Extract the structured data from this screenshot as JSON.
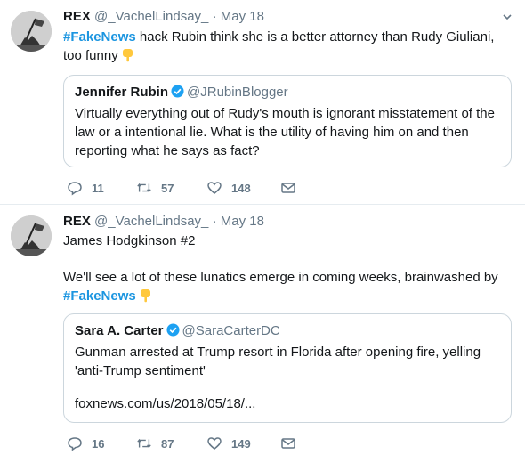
{
  "tweets": [
    {
      "name": "REX",
      "handle": "@_VachelLindsay_",
      "separator": "·",
      "time": "May 18",
      "hashtag": "#FakeNews",
      "text_after_hashtag": " hack Rubin think she is a better attorney than Rudy Giuliani, too funny",
      "emoji": "backhand-index-pointing-down",
      "quote": {
        "name": "Jennifer Rubin",
        "handle": "@JRubinBlogger",
        "text": "Virtually everything out of Rudy's mouth is ignorant misstatement of the law or a intentional lie. What is the utility of having him on and then reporting what he says as fact?"
      },
      "actions": {
        "replies": "11",
        "retweets": "57",
        "likes": "148"
      }
    },
    {
      "name": "REX",
      "handle": "@_VachelLindsay_",
      "separator": "·",
      "time": "May 18",
      "line1": "James Hodgkinson #2",
      "line2": "We'll see a lot of these lunatics emerge in coming weeks, brainwashed by",
      "hashtag": "#FakeNews",
      "emoji": "backhand-index-pointing-down",
      "quote": {
        "name": "Sara A. Carter",
        "handle": "@SaraCarterDC",
        "text": "Gunman arrested at Trump resort in Florida after opening fire, yelling 'anti-Trump sentiment'",
        "link": "foxnews.com/us/2018/05/18/..."
      },
      "actions": {
        "replies": "16",
        "retweets": "87",
        "likes": "149"
      }
    }
  ],
  "colors": {
    "text": "#14171a",
    "secondary": "#657786",
    "hashtag": "#1b95e0",
    "verified": "#1da1f2",
    "border": "#ccd6dd"
  }
}
